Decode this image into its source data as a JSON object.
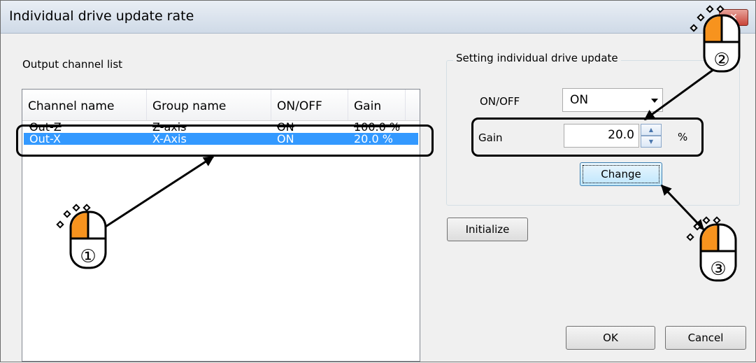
{
  "window": {
    "title": "Individual drive update rate",
    "close_label": "✕"
  },
  "list": {
    "section_label": "Output channel list",
    "columns": [
      "Channel name",
      "Group name",
      "ON/OFF",
      "Gain"
    ],
    "rows": [
      {
        "channel": "Out-Z",
        "group": "Z-axis",
        "onoff": "ON",
        "gain": "100.0 %"
      },
      {
        "channel": "Out-X",
        "group": "X-Axis",
        "onoff": "ON",
        "gain": "20.0 %"
      }
    ]
  },
  "settings": {
    "group_title": "Setting individual drive update",
    "onoff_label": "ON/OFF",
    "onoff_value": "ON",
    "gain_label": "Gain",
    "gain_value": "20.0",
    "gain_unit": "%",
    "change_label": "Change"
  },
  "buttons": {
    "initialize": "Initialize",
    "ok": "OK",
    "cancel": "Cancel"
  },
  "callouts": {
    "step1": "①",
    "step2": "②",
    "step3": "③"
  },
  "colors": {
    "selection": "#3399ff",
    "mouse_button": "#f7931e"
  }
}
